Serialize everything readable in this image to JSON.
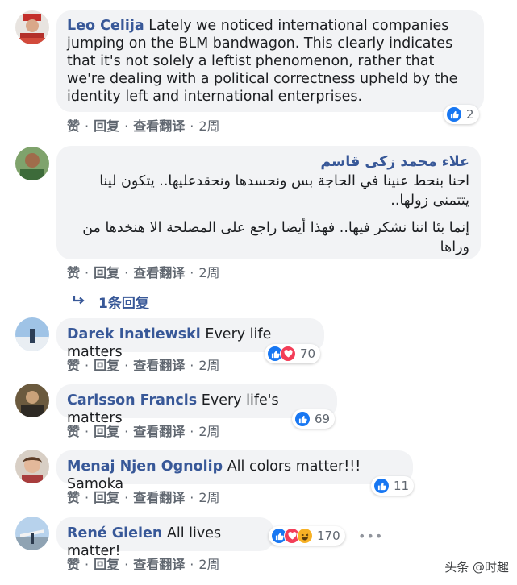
{
  "actions": {
    "like": "赞",
    "reply": "回复",
    "translate": "查看翻译",
    "sep": "·"
  },
  "comments": [
    {
      "name": "Leo Celija",
      "text": "Lately we noticed international companies jumping on the BLM bandwagon. This clearly indicates that it's not solely a leftist phenomenon, rather that we're dealing with a political correctness upheld by the identity left and international enterprises.",
      "reactions": "2",
      "time": "2周"
    },
    {
      "name": "علاء محمد زكى قاسم",
      "text_p1": "احنا بنحط عنينا في الحاجة بس ونحسدها ونحقدعليها.. يتكون لينا يتتمنى زولها..",
      "text_p2": "إنما بئا اننا نشكر فيها.. فهذا أيضا راجع على المصلحة الا هنخدها من وراها",
      "time": "2周",
      "replies": "1条回复"
    },
    {
      "name": "Darek Inatlewski",
      "text": "Every life matters",
      "reactions": "70",
      "time": "2周"
    },
    {
      "name": "Carlsson Francis",
      "text": "Every life's matters",
      "reactions": "69",
      "time": "2周"
    },
    {
      "name": "Menaj Njen Ognolip",
      "text": "All colors matter!!! Samoka",
      "reactions": "11",
      "time": "2周"
    },
    {
      "name": "René Gielen",
      "text": "All lives matter!",
      "reactions": "170",
      "time": "2周"
    }
  ],
  "more_icon": "ellipsis-icon",
  "watermark": "头条 @时趣",
  "colors": {
    "name": "#385898",
    "bubble": "#f2f3f5",
    "like": "#1877f2",
    "love": "#f33e58",
    "haha": "#f7b125"
  }
}
